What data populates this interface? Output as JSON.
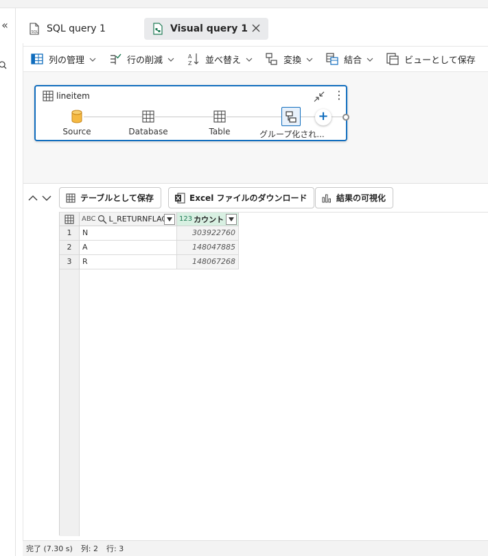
{
  "tabs": [
    {
      "label": "SQL query 1",
      "icon": "sql-file-icon",
      "active": false
    },
    {
      "label": "Visual query 1",
      "icon": "visual-query-icon",
      "active": true
    }
  ],
  "ribbon": {
    "manage_columns": "列の管理",
    "reduce_rows": "行の削減",
    "sort": "並べ替え",
    "transform": "変換",
    "combine": "結合",
    "save_as_view": "ビューとして保存"
  },
  "query": {
    "title": "lineitem",
    "steps": [
      {
        "label": "Source",
        "icon": "database-cylinder-icon"
      },
      {
        "label": "Database",
        "icon": "table-icon"
      },
      {
        "label": "Table",
        "icon": "table-icon"
      },
      {
        "label": "グループ化され...",
        "icon": "group-by-icon"
      }
    ],
    "add_step": "+"
  },
  "results": {
    "save_as_table": "テーブルとして保存",
    "download_excel": "Excel ファイルのダウンロード",
    "visualize": "結果の可視化"
  },
  "grid": {
    "columns": [
      {
        "name": "L_RETURNFLAG",
        "type": "ABC"
      },
      {
        "name": "カウント",
        "type": "123"
      }
    ],
    "rows": [
      {
        "num": "1",
        "flag": "N",
        "count": "303922760"
      },
      {
        "num": "2",
        "flag": "A",
        "count": "148047885"
      },
      {
        "num": "3",
        "flag": "R",
        "count": "148067268"
      }
    ]
  },
  "status": {
    "done": "完了 (7.30 s)",
    "columns": "列: 2",
    "rows": "行: 3"
  },
  "colors": {
    "accent": "#0f6cbd",
    "source_icon": "#e8a317",
    "count_header_bg": "#d8f0e2"
  }
}
